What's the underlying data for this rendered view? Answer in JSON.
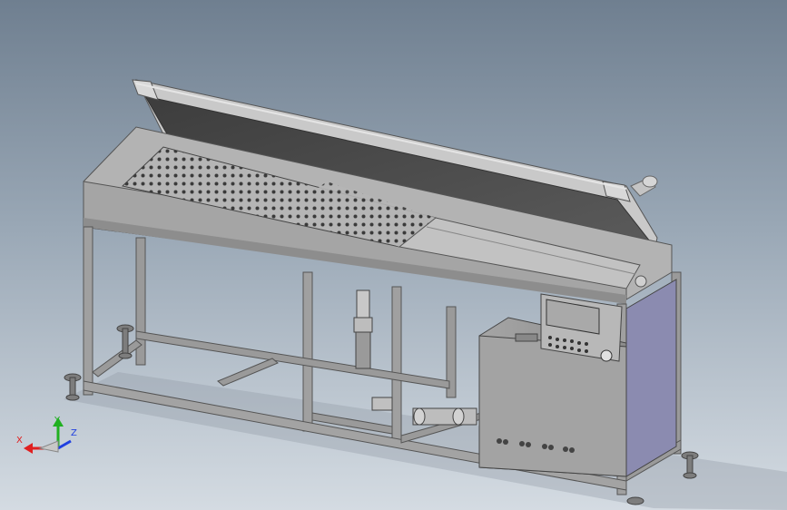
{
  "scene": {
    "machine_colors": {
      "lid_panel": "#4a4a4a",
      "frame": "#9d9d9d",
      "frame_dark": "#6a6a6a",
      "tray": "#a9a9a9",
      "cabinet": "#9a9a9a",
      "cabinet_side": "#8b8bb0",
      "screen": "#b8b8b8"
    }
  },
  "triad": {
    "x_label": "X",
    "y_label": "Y",
    "z_label": "Z",
    "x_color": "#e02020",
    "y_color": "#20b020",
    "z_color": "#2040e0"
  }
}
